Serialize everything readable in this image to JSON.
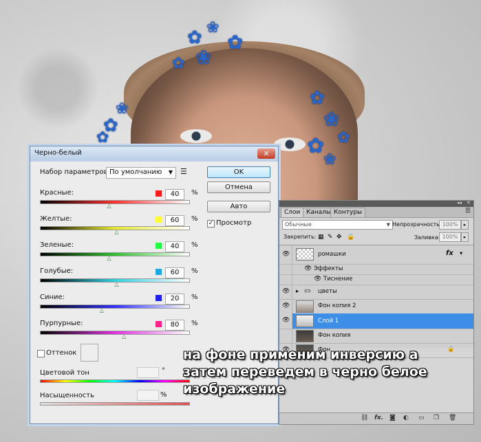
{
  "dialog": {
    "title": "Черно-белый",
    "close_label": "✕",
    "preset_label": "Набор параметров:",
    "preset_value": "По умолчанию",
    "ok_label": "OK",
    "cancel_label": "Отмена",
    "auto_label": "Авто",
    "preview_label": "Просмотр",
    "preview_checked": true,
    "channels": [
      {
        "label": "Красные:",
        "value": "40",
        "color": "#ff1a1a",
        "gradient": [
          "#000000",
          "#ff3030",
          "#ffffff"
        ],
        "thumb": 0.47
      },
      {
        "label": "Желтые:",
        "value": "60",
        "color": "#ffff33",
        "gradient": [
          "#000000",
          "#e8e830",
          "#ffffff"
        ],
        "thumb": 0.52
      },
      {
        "label": "Зеленые:",
        "value": "40",
        "color": "#22ff44",
        "gradient": [
          "#000000",
          "#30c030",
          "#ffffff"
        ],
        "thumb": 0.47
      },
      {
        "label": "Голубые:",
        "value": "60",
        "color": "#1fa8e0",
        "gradient": [
          "#000000",
          "#30d0e0",
          "#ffffff"
        ],
        "thumb": 0.52
      },
      {
        "label": "Синие:",
        "value": "20",
        "color": "#2020ee",
        "gradient": [
          "#000000",
          "#3030ff",
          "#ffffff"
        ],
        "thumb": 0.42
      },
      {
        "label": "Пурпурные:",
        "value": "80",
        "color": "#ff2288",
        "gradient": [
          "#000000",
          "#e030e0",
          "#ffffff"
        ],
        "thumb": 0.57
      }
    ],
    "pct": "%",
    "tint_label": "Оттенок",
    "tint_checked": false,
    "hue_label": "Цветовой тон",
    "hue_unit": "°",
    "saturation_label": "Насыщенность",
    "saturation_unit": "%"
  },
  "layers_panel": {
    "tabs": [
      "Слои",
      "Каналы",
      "Контуры"
    ],
    "active_tab": 0,
    "blend_mode": "Обычные",
    "opacity_label": "Непрозрачность:",
    "opacity_value": "100%",
    "lock_label": "Закрепить:",
    "fill_label": "Заливка:",
    "fill_value": "100%",
    "layers": [
      {
        "name": "ромашки",
        "visible": true,
        "fx": "fx",
        "type": "layer"
      },
      {
        "name": "Эффекты",
        "visible": true,
        "type": "effects"
      },
      {
        "name": "Тиснение",
        "visible": true,
        "type": "effect"
      },
      {
        "name": "цветы",
        "visible": true,
        "type": "group"
      },
      {
        "name": "Фон копия 2",
        "visible": true,
        "type": "layer"
      },
      {
        "name": "Слой 1",
        "visible": true,
        "type": "layer",
        "selected": true
      },
      {
        "name": "Фон копия",
        "visible": false,
        "type": "layer"
      },
      {
        "name": "Фон",
        "visible": true,
        "type": "layer",
        "locked": true
      }
    ],
    "fx_footer": "fx."
  },
  "caption": "на фоне применим инверсию а\nзатем переведем в черно белое\nизображение"
}
